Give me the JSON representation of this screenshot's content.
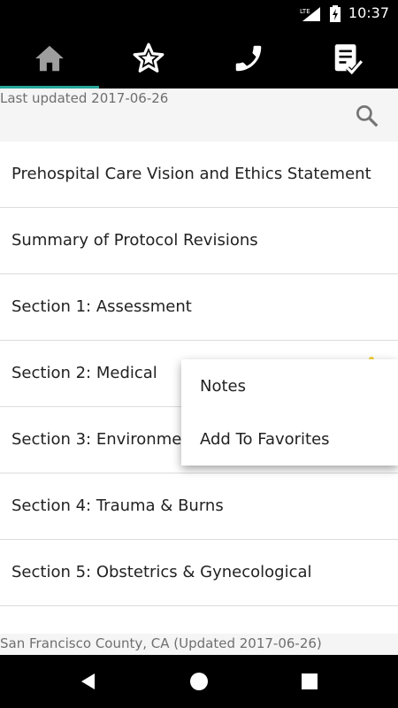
{
  "status": {
    "time": "10:37",
    "lte": "LTE"
  },
  "tabs": [
    {
      "name": "home",
      "icon": "home-icon"
    },
    {
      "name": "favorites",
      "icon": "star-icon"
    },
    {
      "name": "contacts",
      "icon": "phone-icon"
    },
    {
      "name": "checklist",
      "icon": "checklist-icon"
    }
  ],
  "header": {
    "last_updated": "Last updated 2017-06-26"
  },
  "sections": [
    "Prehospital Care Vision and Ethics Statement",
    "Summary of Protocol Revisions",
    "Section 1: Assessment",
    "Section 2: Medical",
    "Section 3: Environmental",
    "Section 4: Trauma & Burns",
    "Section 5: Obstetrics & Gynecological"
  ],
  "footer": {
    "text": "San Francisco County, CA (Updated 2017-06-26)"
  },
  "context_menu": {
    "notes": "Notes",
    "add_favorites": "Add To Favorites"
  },
  "colors": {
    "accent": "#26a69a",
    "bar": "#000000"
  }
}
